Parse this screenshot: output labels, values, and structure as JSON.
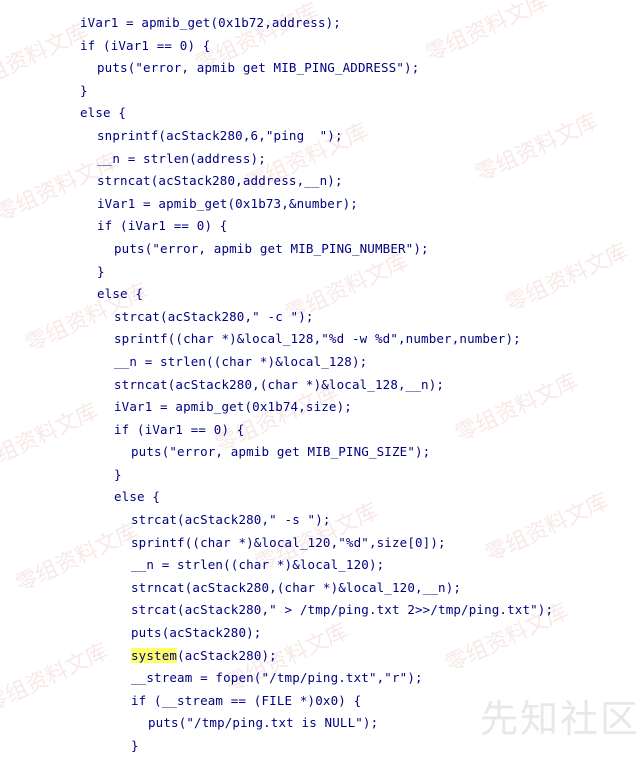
{
  "code_lines": [
    {
      "indent": 0,
      "text": "iVar1 = apmib_get(0x1b72,address);"
    },
    {
      "indent": 0,
      "text": "if (iVar1 == 0) {"
    },
    {
      "indent": 1,
      "text": "puts(\"error, apmib get MIB_PING_ADDRESS\");"
    },
    {
      "indent": 0,
      "text": "}"
    },
    {
      "indent": 0,
      "text": "else {"
    },
    {
      "indent": 1,
      "text": "snprintf(acStack280,6,\"ping  \");"
    },
    {
      "indent": 1,
      "text": "__n = strlen(address);"
    },
    {
      "indent": 1,
      "text": "strncat(acStack280,address,__n);"
    },
    {
      "indent": 1,
      "text": "iVar1 = apmib_get(0x1b73,&number);"
    },
    {
      "indent": 1,
      "text": "if (iVar1 == 0) {"
    },
    {
      "indent": 2,
      "text": "puts(\"error, apmib get MIB_PING_NUMBER\");"
    },
    {
      "indent": 1,
      "text": "}"
    },
    {
      "indent": 1,
      "text": "else {"
    },
    {
      "indent": 2,
      "text": "strcat(acStack280,\" -c \");"
    },
    {
      "indent": 2,
      "text": "sprintf((char *)&local_128,\"%d -w %d\",number,number);"
    },
    {
      "indent": 2,
      "text": "__n = strlen((char *)&local_128);"
    },
    {
      "indent": 2,
      "text": "strncat(acStack280,(char *)&local_128,__n);"
    },
    {
      "indent": 2,
      "text": "iVar1 = apmib_get(0x1b74,size);"
    },
    {
      "indent": 2,
      "text": "if (iVar1 == 0) {"
    },
    {
      "indent": 3,
      "text": "puts(\"error, apmib get MIB_PING_SIZE\");"
    },
    {
      "indent": 2,
      "text": "}"
    },
    {
      "indent": 2,
      "text": "else {"
    },
    {
      "indent": 3,
      "text": "strcat(acStack280,\" -s \");"
    },
    {
      "indent": 3,
      "text": "sprintf((char *)&local_120,\"%d\",size[0]);"
    },
    {
      "indent": 3,
      "text": "__n = strlen((char *)&local_120);"
    },
    {
      "indent": 3,
      "text": "strncat(acStack280,(char *)&local_120,__n);"
    },
    {
      "indent": 3,
      "text": "strcat(acStack280,\" > /tmp/ping.txt 2>>/tmp/ping.txt\");"
    },
    {
      "indent": 3,
      "text": "puts(acStack280);"
    },
    {
      "indent": 3,
      "text": "system(acStack280);",
      "highlight": "system"
    },
    {
      "indent": 3,
      "text": "__stream = fopen(\"/tmp/ping.txt\",\"r\");"
    },
    {
      "indent": 3,
      "text": "if (__stream == (FILE *)0x0) {"
    },
    {
      "indent": 4,
      "text": "puts(\"/tmp/ping.txt is NULL\");"
    },
    {
      "indent": 3,
      "text": "}"
    }
  ],
  "watermark_text": "零组资料文库",
  "logo_text": "先知社区",
  "colors": {
    "code_text": "#000080",
    "highlight": "#ffff66",
    "background": "#ffffff"
  }
}
